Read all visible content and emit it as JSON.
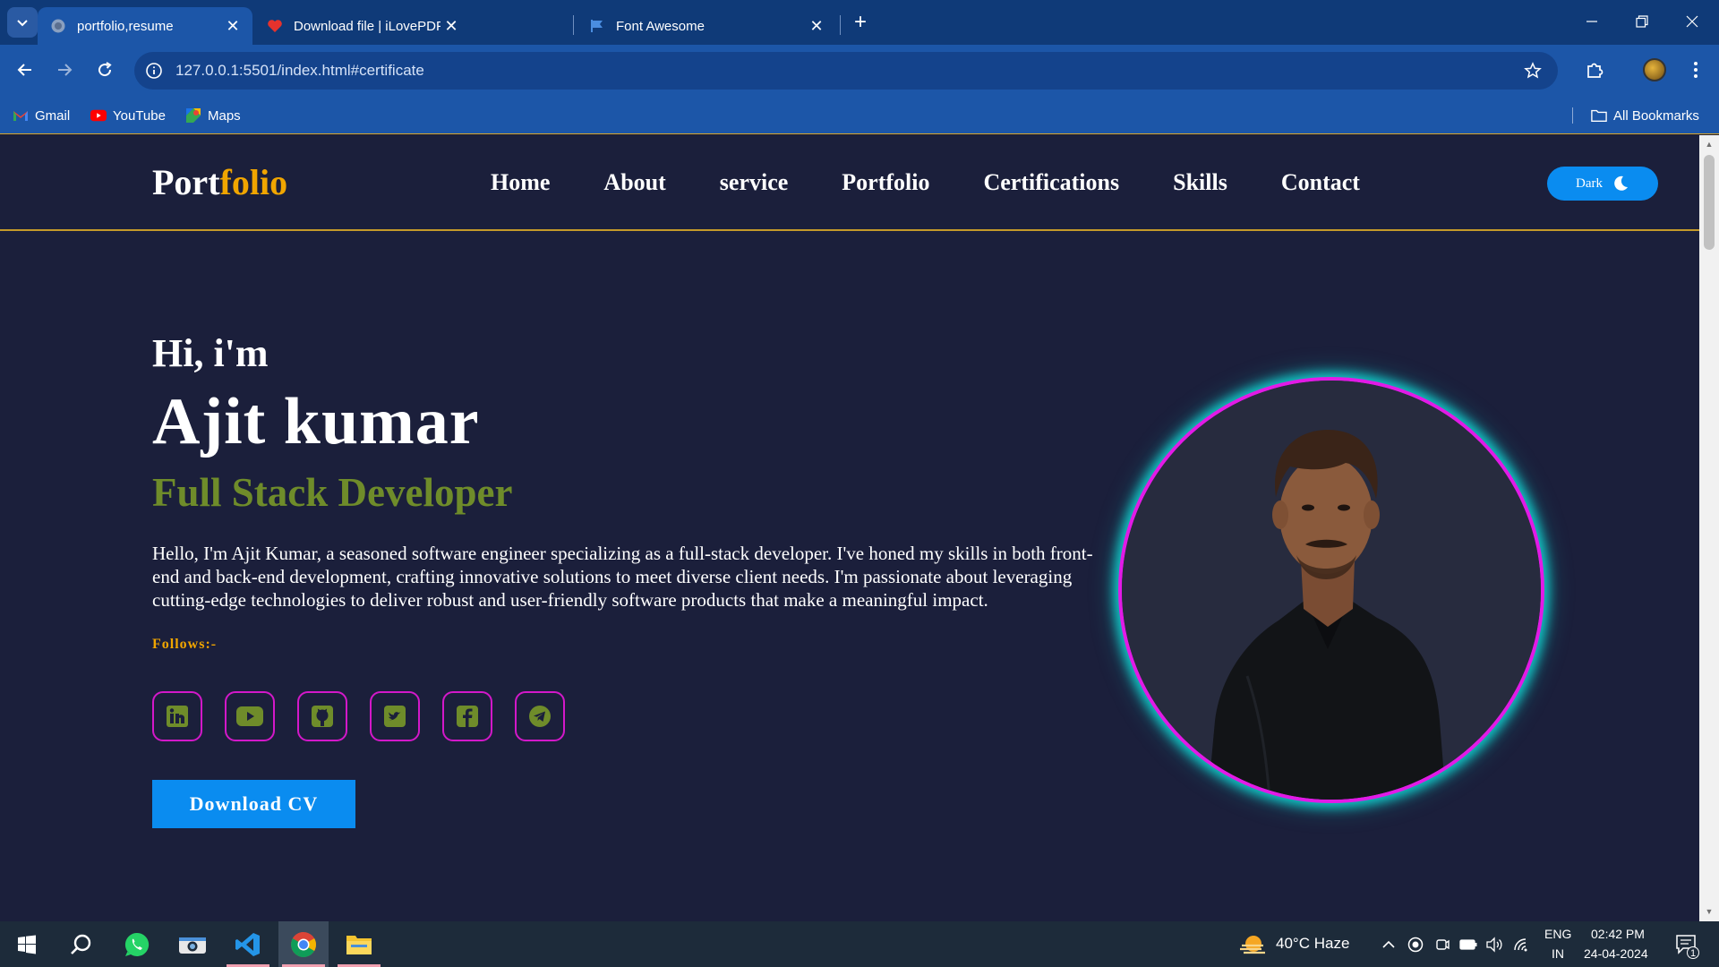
{
  "browser": {
    "tabs": [
      {
        "title": "portfolio,resume",
        "active": true,
        "icon": "globe-icon"
      },
      {
        "title": "Download file | iLovePDF",
        "active": false,
        "icon": "heart-icon"
      },
      {
        "title": "Font Awesome",
        "active": false,
        "icon": "flag-icon"
      }
    ],
    "url": "127.0.0.1:5501/index.html#certificate",
    "bookmarks": [
      {
        "label": "Gmail",
        "icon": "gmail-icon"
      },
      {
        "label": "YouTube",
        "icon": "youtube-icon"
      },
      {
        "label": "Maps",
        "icon": "maps-icon"
      }
    ],
    "all_bookmarks_label": "All Bookmarks"
  },
  "site": {
    "logo_main": "Port",
    "logo_accent": "folio",
    "nav": [
      "Home",
      "About",
      "service",
      "Portfolio",
      "Certifications",
      "Skills",
      "Contact"
    ],
    "theme_toggle_label": "Dark"
  },
  "hero": {
    "greeting": "Hi, i'm",
    "name": "Ajit kumar",
    "role": "Full Stack Developer",
    "bio": "Hello, I'm Ajit Kumar, a seasoned software engineer specializing as a full-stack developer. I've honed my skills in both front-end and back-end development, crafting innovative solutions to meet diverse client needs. I'm passionate about leveraging cutting-edge technologies to deliver robust and user-friendly software products that make a meaningful impact.",
    "follows_label": "Follows:-",
    "socials": [
      "linkedin-icon",
      "youtube-icon",
      "github-icon",
      "twitter-icon",
      "facebook-icon",
      "telegram-icon"
    ],
    "cta_label": "Download CV"
  },
  "taskbar": {
    "weather": "40°C  Haze",
    "lang_top": "ENG",
    "lang_bottom": "IN",
    "time": "02:42 PM",
    "date": "24-04-2024",
    "notification_count": "1"
  },
  "colors": {
    "accent_orange": "#f0a500",
    "role_green": "#6f8c2a",
    "button_blue": "#0a8cf0",
    "social_border": "#d318c9",
    "page_bg": "#1b1f3b"
  }
}
